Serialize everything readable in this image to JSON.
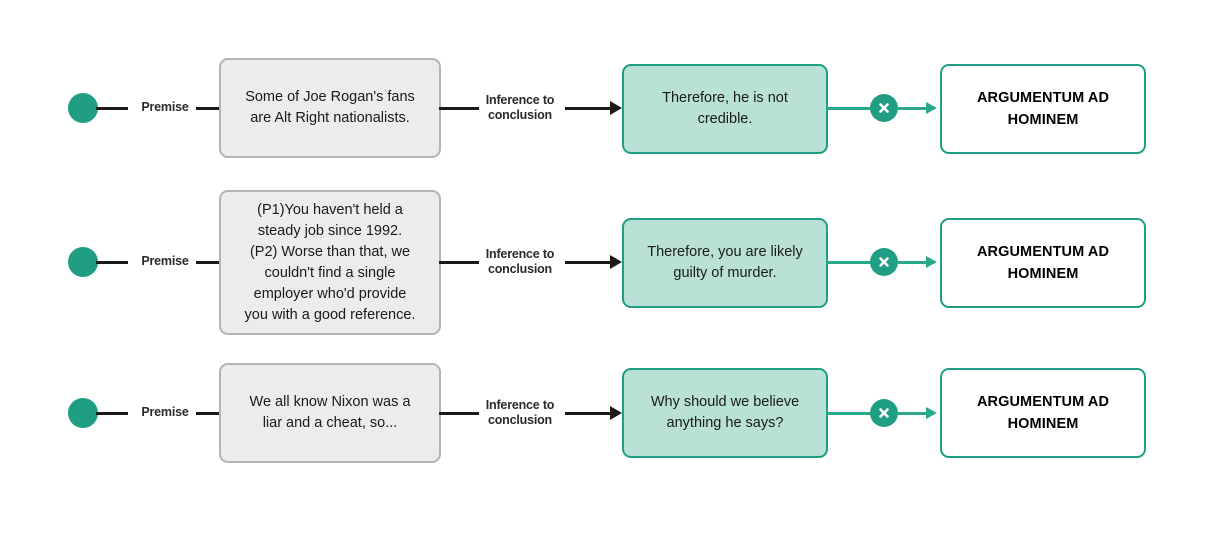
{
  "diagram": {
    "title": "Argumentum ad Hominem fallacy structure",
    "colors": {
      "node_teal": "#1f9e84",
      "connector_teal": "#2aa88c",
      "conclusion_fill": "#b9e1d5",
      "premise_fill": "#ececec",
      "premise_border": "#b3b3b3",
      "line_black": "#1a1a1a",
      "background": "#ffffff"
    },
    "edge_labels": {
      "premise": "Premise",
      "inference": "Inference to\nconclusion"
    },
    "badge_icon": "x-circle-icon",
    "start_icon": "start-node-circle",
    "rows": [
      {
        "premise": "Some of Joe Rogan's fans\nare Alt Right nationalists.",
        "conclusion": "Therefore, he is not\ncredible.",
        "fallacy": "ARGUMENTUM AD\nHOMINEM"
      },
      {
        "premise": "(P1)You haven't held a\nsteady job since 1992.\n(P2) Worse than that, we\ncouldn't find a single\nemployer who'd provide\nyou with a good reference.",
        "conclusion": "Therefore, you are likely\nguilty of murder.",
        "fallacy": "ARGUMENTUM AD\nHOMINEM"
      },
      {
        "premise": "We all know Nixon was a\nliar and a cheat, so...",
        "conclusion": "Why should we believe\nanything he says?",
        "fallacy": "ARGUMENTUM AD\nHOMINEM"
      }
    ]
  }
}
